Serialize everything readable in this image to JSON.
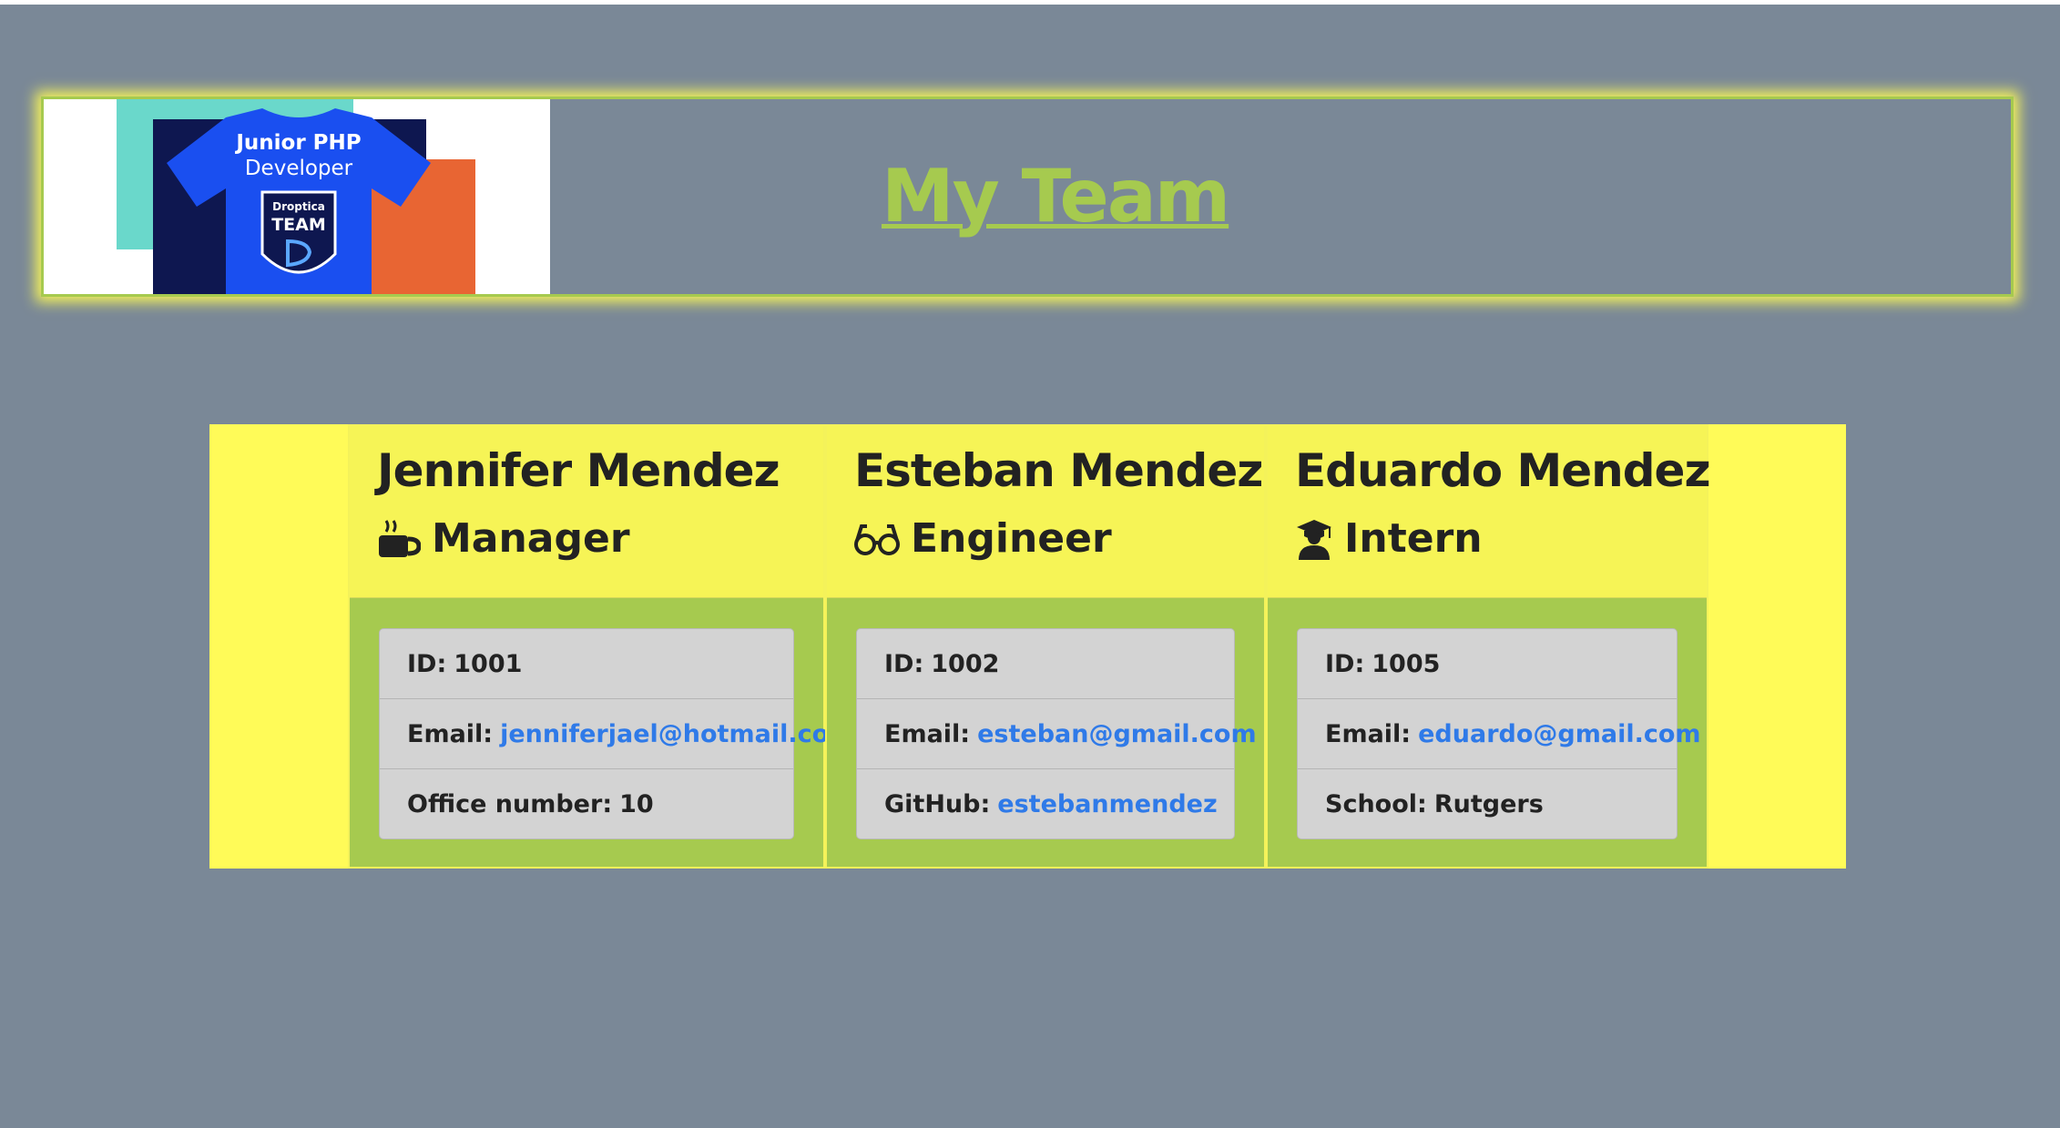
{
  "header": {
    "title": "My Team",
    "logo": {
      "line1": "Junior PHP",
      "line2": "Developer",
      "badge_top": "Droptica",
      "badge_mid": "TEAM"
    }
  },
  "team": [
    {
      "name": "Jennifer Mendez",
      "role": "Manager",
      "role_icon": "coffee-mug-icon",
      "id_label": "ID:",
      "id_value": "1001",
      "email_label": "Email:",
      "email_value": "jenniferjael@hotmail.com",
      "extra_label": "Office number:",
      "extra_value": "10"
    },
    {
      "name": "Esteban Mendez",
      "role": "Engineer",
      "role_icon": "glasses-icon",
      "id_label": "ID:",
      "id_value": "1002",
      "email_label": "Email:",
      "email_value": "esteban@gmail.com",
      "extra_label": "GitHub:",
      "extra_value": "estebanmendez"
    },
    {
      "name": "Eduardo Mendez",
      "role": "Intern",
      "role_icon": "graduate-icon",
      "id_label": "ID:",
      "id_value": "1005",
      "email_label": "Email:",
      "email_value": "eduardo@gmail.com",
      "extra_label": "School:",
      "extra_value": "Rutgers"
    }
  ],
  "colors": {
    "background": "#7a8897",
    "accent_green": "#a6ca4f",
    "accent_yellow": "#fffb58",
    "link_blue": "#2f7ae8"
  }
}
